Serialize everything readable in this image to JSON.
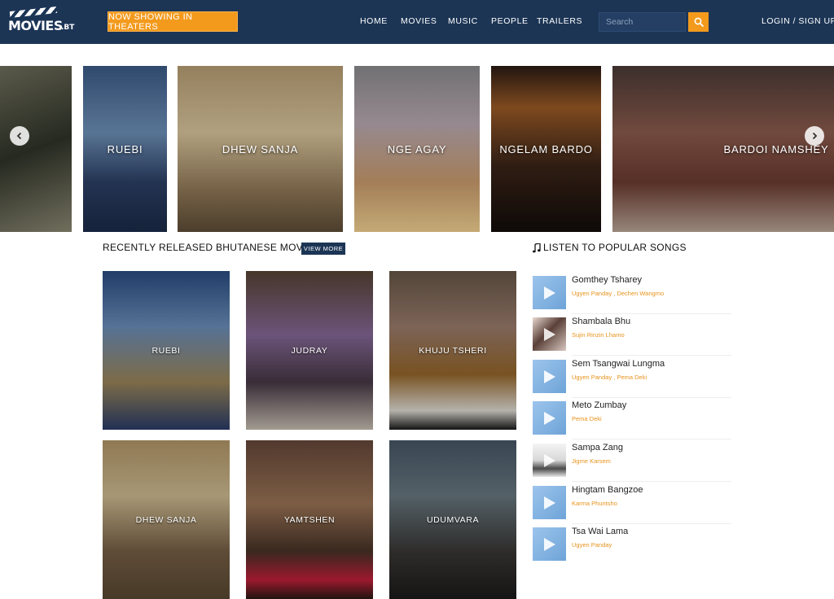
{
  "header": {
    "logo_text": "MOVIES",
    "logo_tld": ".BT",
    "now_showing_label": "NOW SHOWING IN THEATERS",
    "nav": [
      "HOME",
      "MOVIES",
      "MUSIC",
      "PEOPLE",
      "TRAILERS"
    ],
    "search_placeholder": "Search",
    "login_label": "LOGIN / SIGN UP"
  },
  "carousel": {
    "slides": [
      "RUEBI",
      "DHEW SANJA",
      "NGE AGAY",
      "NGELAM BARDO",
      "BARDOI NAMSHEY"
    ]
  },
  "recent": {
    "title": "RECENTLY RELEASED BHUTANESE MOVIES",
    "view_more_label": "VIEW MORE",
    "movies": [
      "RUEBI",
      "JUDRAY",
      "KHUJU TSHERI",
      "DHEW SANJA",
      "YAMTSHEN",
      "UDUMVARA"
    ]
  },
  "songs": {
    "title": "LISTEN TO POPULAR SONGS",
    "items": [
      {
        "name": "Gomthey Tsharey",
        "artists": "Ugyen Panday , Dechen Wangmo"
      },
      {
        "name": "Shambala Bhu",
        "artists": "Sujin Rinzin Lhamo"
      },
      {
        "name": "Sem Tsangwai Lungma",
        "artists": "Ugyen Panday , Pema Deki"
      },
      {
        "name": "Meto Zumbay",
        "artists": "Pema Deki"
      },
      {
        "name": "Sampa Zang",
        "artists": "Jigme Karsem"
      },
      {
        "name": "Hingtam Bangzoe",
        "artists": "Karma Phuntsho"
      },
      {
        "name": "Tsa Wai Lama",
        "artists": "Ugyen Panday"
      }
    ]
  },
  "colors": {
    "navbar": "#1c3555",
    "accent": "#f39a1d",
    "artist_text": "#e8931c"
  },
  "icons": {
    "search": "search-icon",
    "music_note": "music-note-icon",
    "play": "play-icon",
    "prev": "chevron-left-icon",
    "next": "chevron-right-icon"
  }
}
